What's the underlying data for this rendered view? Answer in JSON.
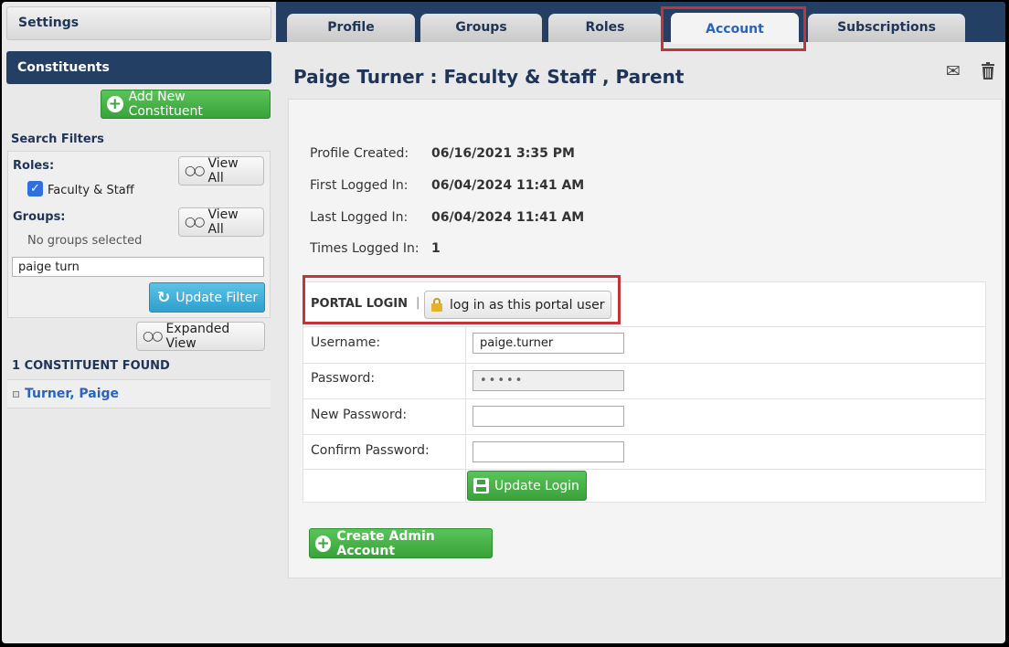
{
  "sidebar": {
    "settings_label": "Settings",
    "constituents_label": "Constituents",
    "add_button": "Add New Constituent",
    "search_filters_title": "Search Filters",
    "roles_label": "Roles:",
    "view_all_label": "View All",
    "role_checked": "Faculty & Staff",
    "groups_label": "Groups:",
    "no_groups": "No groups selected",
    "search_value": "paige turn",
    "update_filter": "Update Filter",
    "expanded_view": "Expanded View",
    "found_count": "1 CONSTITUENT FOUND",
    "result_name": "Turner, Paige"
  },
  "tabs": [
    {
      "label": "Profile",
      "active": false
    },
    {
      "label": "Groups",
      "active": false
    },
    {
      "label": "Roles",
      "active": false
    },
    {
      "label": "Account",
      "active": true
    },
    {
      "label": "Subscriptions",
      "active": false
    }
  ],
  "main": {
    "title": "Paige Turner : Faculty & Staff , Parent",
    "info": [
      {
        "label": "Profile Created:",
        "value": "06/16/2021 3:35 PM"
      },
      {
        "label": "First Logged In:",
        "value": "06/04/2024 11:41 AM"
      },
      {
        "label": "Last Logged In:",
        "value": "06/04/2024 11:41 AM"
      },
      {
        "label": "Times Logged In:",
        "value": "1"
      }
    ],
    "portal_login_label": "PORTAL LOGIN",
    "separator": "|",
    "login_as_label": "log in as this portal user",
    "fields": {
      "username_label": "Username:",
      "username_value": "paige.turner",
      "password_label": "Password:",
      "password_value": "•••••",
      "new_password_label": "New Password:",
      "confirm_password_label": "Confirm Password:"
    },
    "update_login": "Update Login",
    "create_admin": "Create Admin Account"
  },
  "colors": {
    "navy": "#233f63",
    "green": "#3aa53b",
    "blue_button": "#2f9fcd",
    "highlight_red": "#c0353a",
    "link_blue": "#2a63b8"
  },
  "icons": [
    "plus-circle-icon",
    "glasses-icon",
    "checkbox-icon",
    "refresh-icon",
    "mail-icon",
    "trash-icon",
    "lock-icon",
    "save-icon"
  ]
}
